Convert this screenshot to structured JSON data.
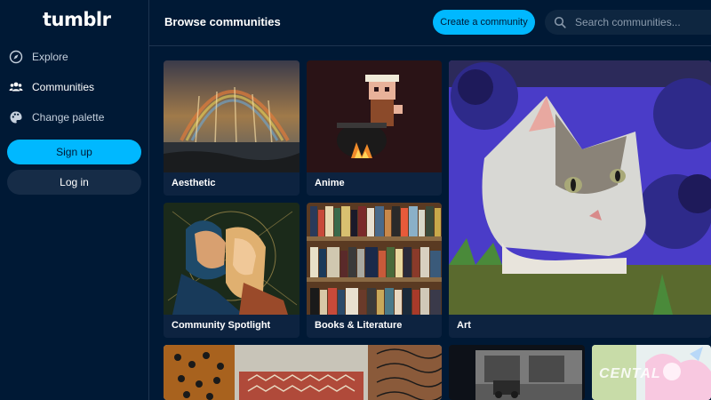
{
  "brand": {
    "logo": "tumblr",
    "accent": "#00b8ff",
    "background": "#001935"
  },
  "sidebar": {
    "items": [
      {
        "label": "Explore",
        "icon": "compass-icon"
      },
      {
        "label": "Communities",
        "icon": "people-icon"
      },
      {
        "label": "Change palette",
        "icon": "palette-icon"
      }
    ],
    "signup_label": "Sign up",
    "login_label": "Log in"
  },
  "header": {
    "title": "Browse communities",
    "create_label": "Create a community",
    "search_placeholder": "Search communities..."
  },
  "communities": [
    {
      "name": "Aesthetic"
    },
    {
      "name": "Anime"
    },
    {
      "name": "Art"
    },
    {
      "name": "Community Spotlight"
    },
    {
      "name": "Books & Literature"
    }
  ],
  "watermark": "CENTAL"
}
